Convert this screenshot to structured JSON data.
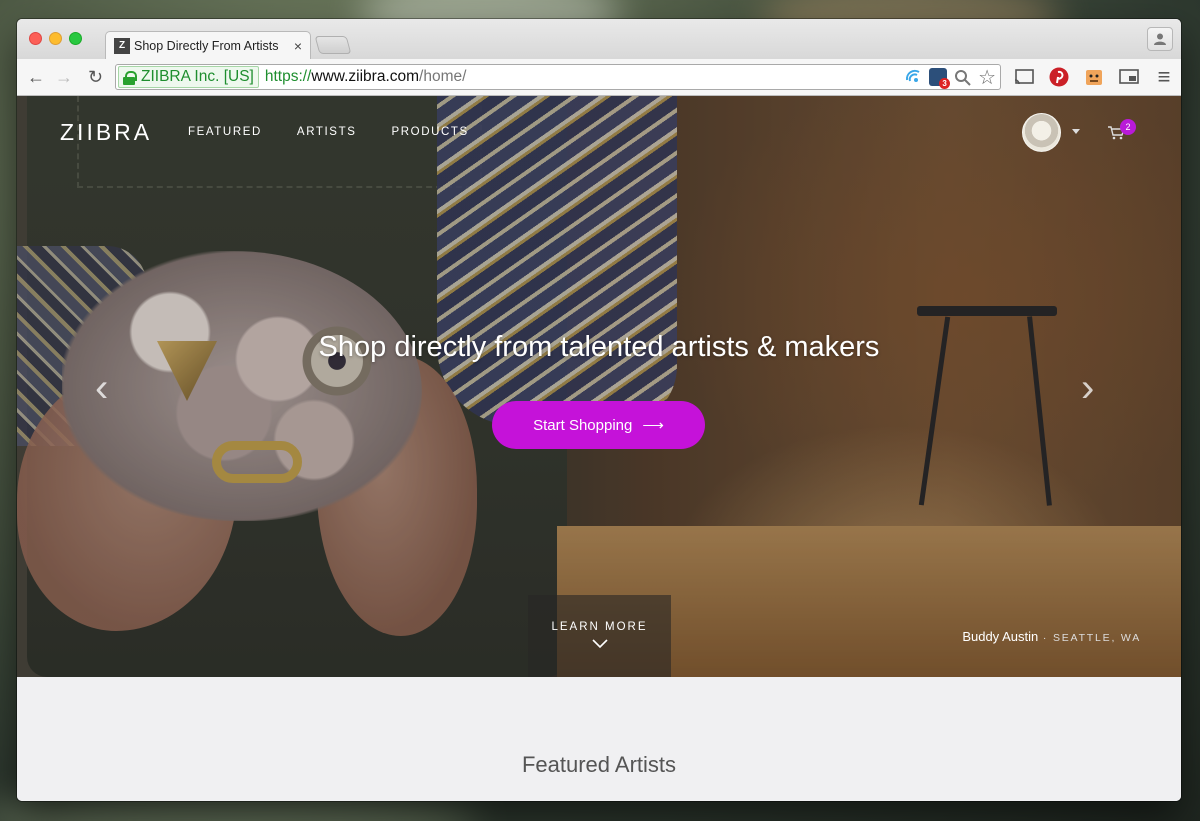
{
  "browser": {
    "tab_title": "Shop Directly From Artists",
    "tab_favicon_letter": "Z",
    "close_glyph": "×",
    "ev_label": "ZIIBRA Inc. [US]",
    "url_scheme": "https://",
    "url_host": "www.ziibra.com",
    "url_path": "/home/",
    "back_glyph": "←",
    "forward_glyph": "→",
    "reload_glyph": "↻",
    "extension_badge": "3",
    "star_glyph": "☆",
    "menu_glyph": "≡"
  },
  "site": {
    "logo": "ZIIBRA",
    "nav": [
      "FEATURED",
      "ARTISTS",
      "PRODUCTS"
    ],
    "cart_count": "2",
    "hero": {
      "headline": "Shop directly from talented artists & makers",
      "cta_label": "Start Shopping",
      "cta_arrow": "⟶",
      "prev_glyph": "‹",
      "next_glyph": "›",
      "learn_more": "LEARN MORE",
      "learn_more_chevron": "⌄",
      "credit_name": "Buddy Austin",
      "credit_separator": " · ",
      "credit_location": "SEATTLE, WA"
    },
    "featured_heading": "Featured Artists"
  },
  "colors": {
    "accent": "#c512d9",
    "badge": "#b91ad8",
    "ev_green": "#1e8e2e"
  }
}
